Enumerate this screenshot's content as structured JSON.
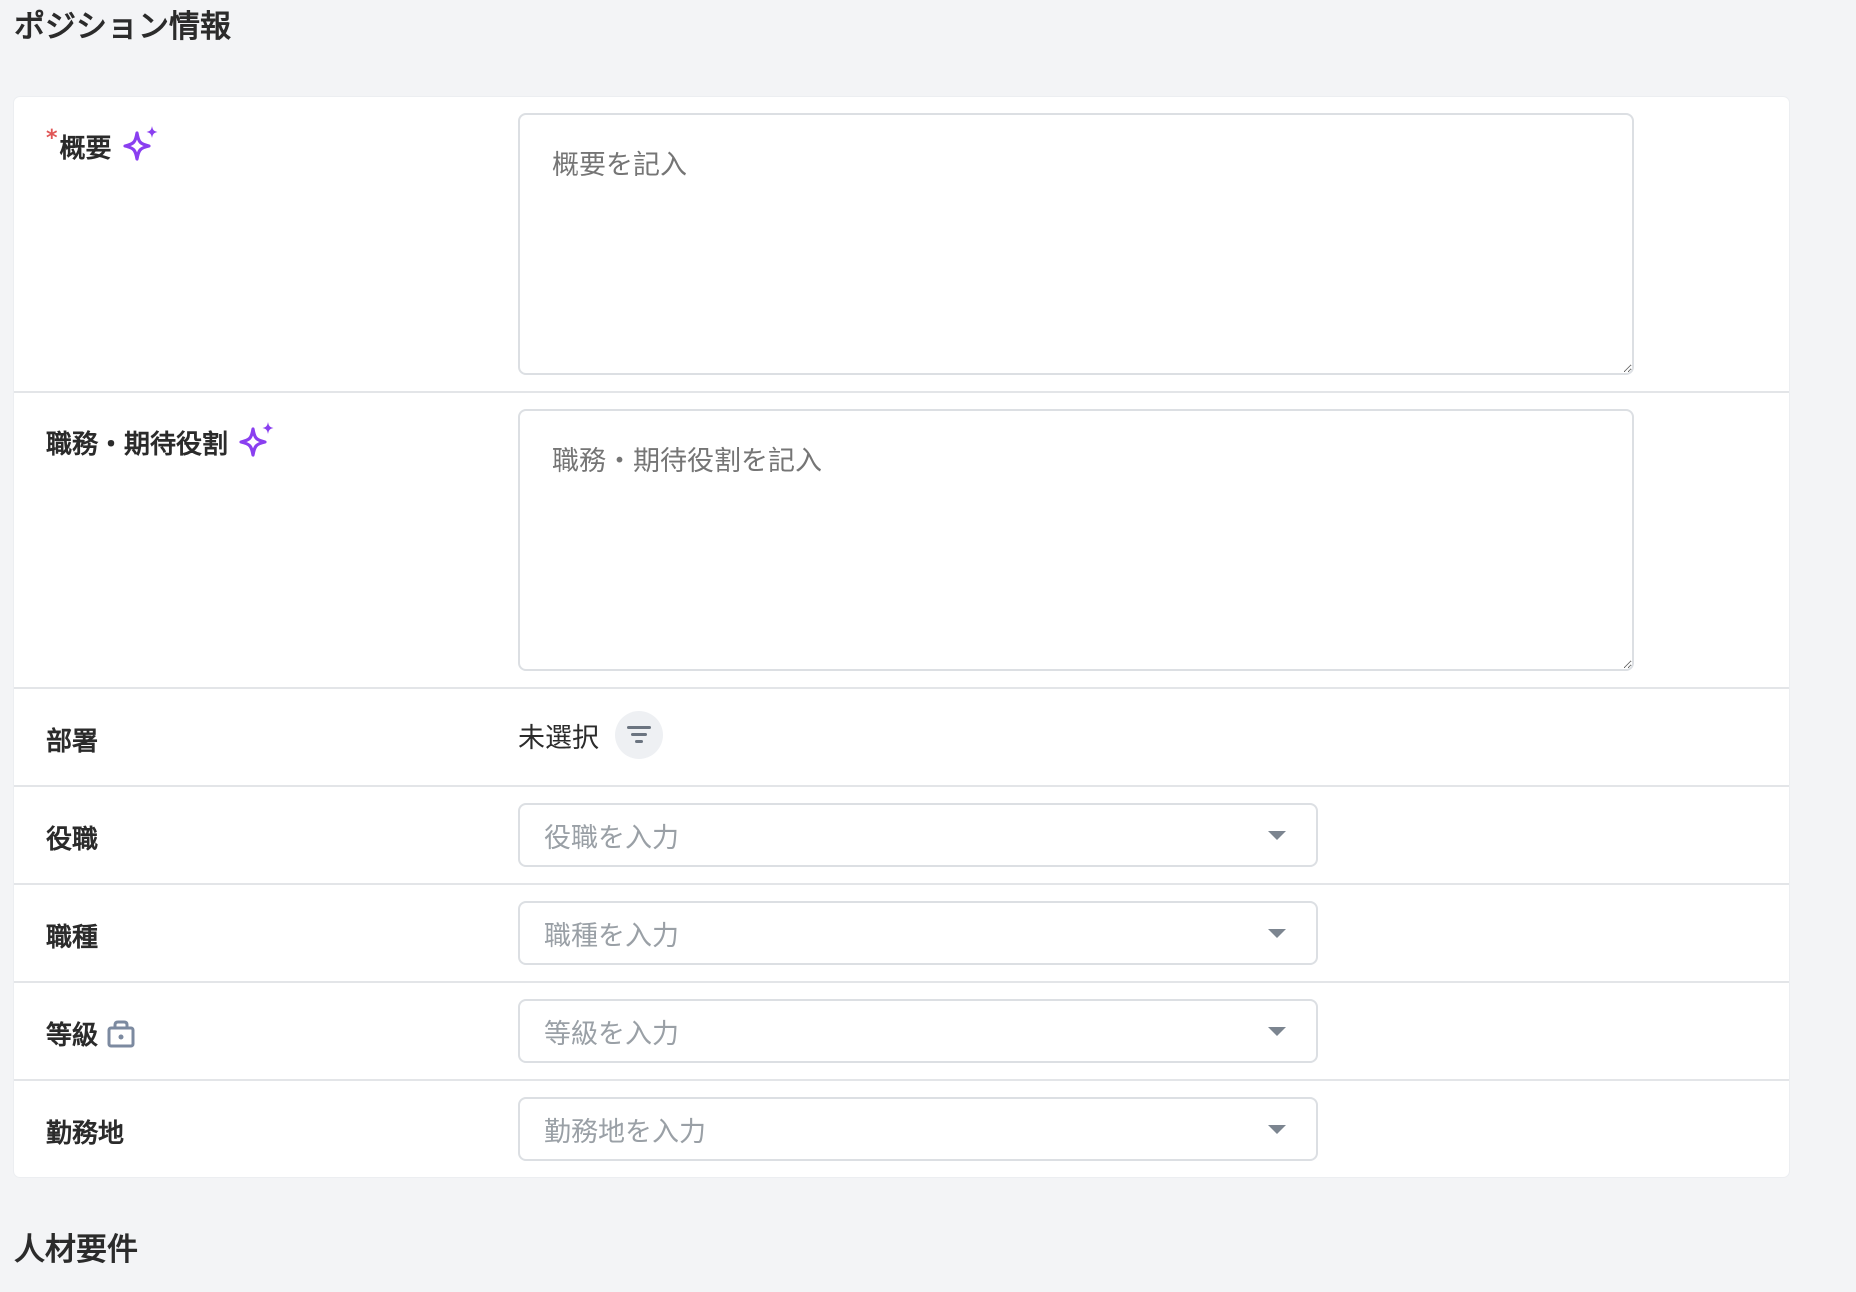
{
  "sections": {
    "position_title": "ポジション情報",
    "talent_title": "人材要件"
  },
  "fields": {
    "overview": {
      "required_mark": "*",
      "label": "概要",
      "placeholder": "概要を記入",
      "icon": "sparkle-icon"
    },
    "duties": {
      "label": "職務・期待役割",
      "placeholder": "職務・期待役割を記入",
      "icon": "sparkle-icon"
    },
    "department": {
      "label": "部署",
      "value": "未選択",
      "icon": "filter-icon"
    },
    "job_title": {
      "label": "役職",
      "placeholder": "役職を入力"
    },
    "job_type": {
      "label": "職種",
      "placeholder": "職種を入力"
    },
    "grade": {
      "label": "等級",
      "placeholder": "等級を入力",
      "icon": "lock-icon"
    },
    "location": {
      "label": "勤務地",
      "placeholder": "勤務地を入力"
    }
  },
  "colors": {
    "accent_sparkle": "#8a3ff0",
    "required": "#e05656",
    "lock_icon": "#7c8aa0"
  }
}
